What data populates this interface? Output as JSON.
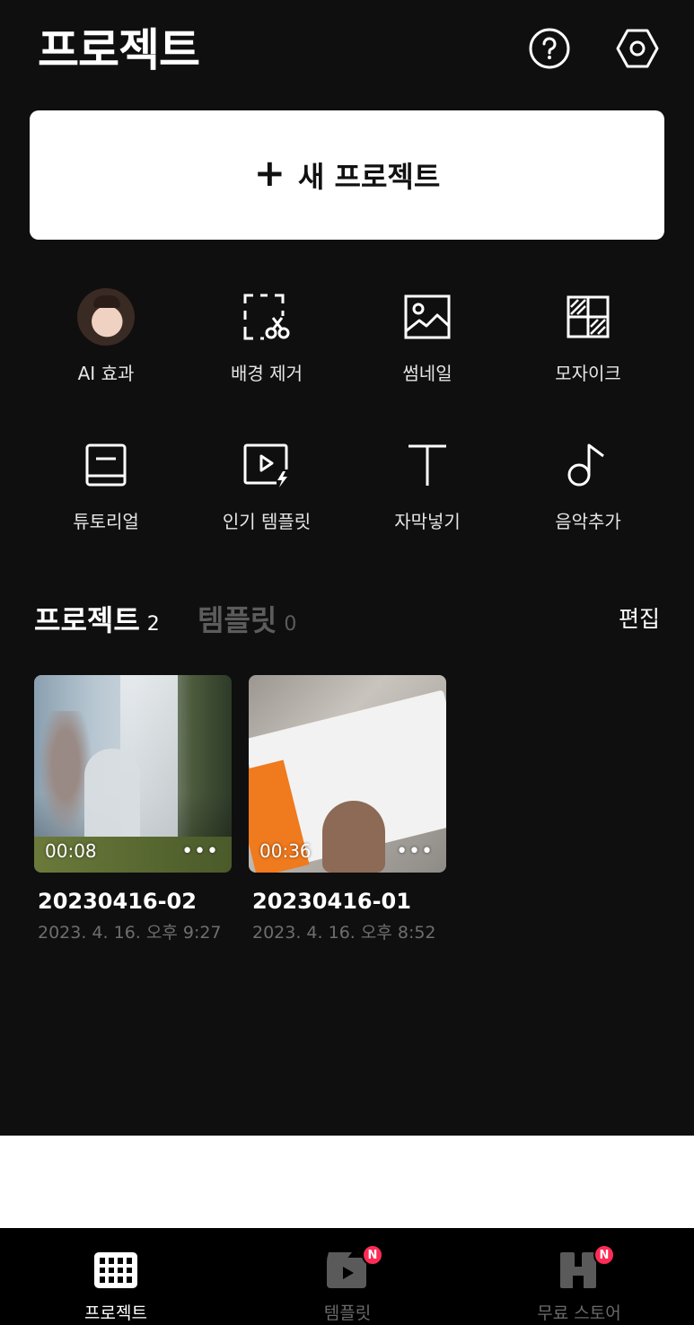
{
  "header": {
    "title": "프로젝트"
  },
  "new_project": {
    "plus": "+",
    "label": "새 프로젝트"
  },
  "tools": [
    {
      "label": "AI 효과",
      "icon": "ai-avatar"
    },
    {
      "label": "배경 제거",
      "icon": "scissors-selection-icon"
    },
    {
      "label": "썸네일",
      "icon": "image-icon"
    },
    {
      "label": "모자이크",
      "icon": "mosaic-icon"
    },
    {
      "label": "튜토리얼",
      "icon": "book-icon"
    },
    {
      "label": "인기 템플릿",
      "icon": "video-template-icon"
    },
    {
      "label": "자막넣기",
      "icon": "text-icon"
    },
    {
      "label": "음악추가",
      "icon": "music-note-icon"
    }
  ],
  "tabs": {
    "projects_label": "프로젝트",
    "projects_count": "2",
    "templates_label": "템플릿",
    "templates_count": "0",
    "edit_label": "편집"
  },
  "projects": [
    {
      "duration": "00:08",
      "more": "•••",
      "name": "20230416-02",
      "date": "2023. 4. 16. 오후 9:27"
    },
    {
      "duration": "00:36",
      "more": "•••",
      "name": "20230416-01",
      "date": "2023. 4. 16. 오후 8:52"
    }
  ],
  "bottom_nav": [
    {
      "label": "프로젝트",
      "active": true
    },
    {
      "label": "템플릿",
      "badge": "N"
    },
    {
      "label": "무료 스토어",
      "badge": "N"
    }
  ],
  "colors": {
    "background": "#0f0f0f",
    "badge": "#fe2c55",
    "inactive": "#6a6a6a"
  }
}
